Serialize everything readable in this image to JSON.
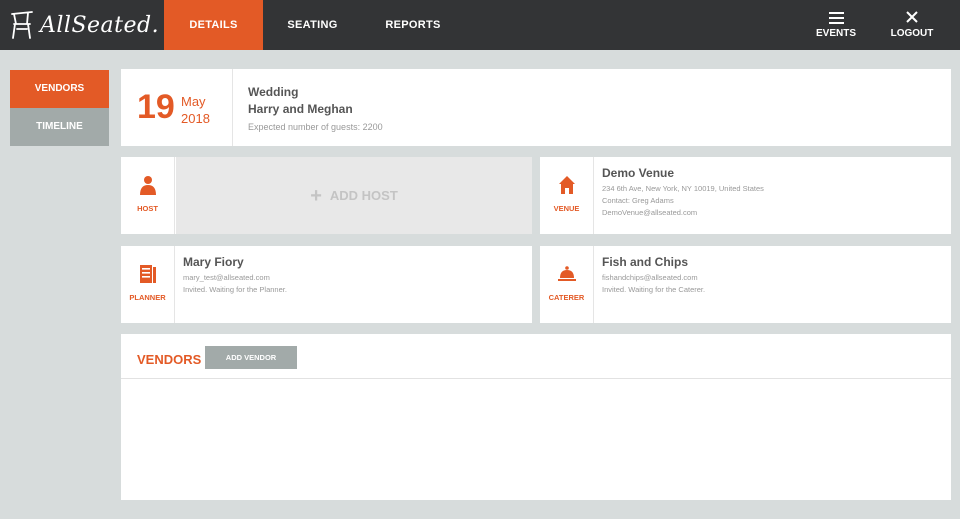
{
  "app": {
    "logo_text": "AllSeated."
  },
  "topbar": {
    "tabs": [
      {
        "label": "DETAILS",
        "active": true
      },
      {
        "label": "SEATING",
        "active": false
      },
      {
        "label": "REPORTS",
        "active": false
      }
    ],
    "actions": [
      {
        "label": "EVENTS",
        "icon": "hamburger-menu-icon"
      },
      {
        "label": "LOGOUT",
        "icon": "close-icon"
      }
    ]
  },
  "sidebar": {
    "items": [
      {
        "label": "VENDORS",
        "active": true
      },
      {
        "label": "TIMELINE",
        "active": false
      }
    ]
  },
  "event": {
    "day": "19",
    "month": "May",
    "year": "2018",
    "type": "Wedding",
    "name": "Harry and Meghan",
    "guests": "Expected number of guests: 2200"
  },
  "host": {
    "role": "HOST",
    "add_label": "ADD HOST",
    "icon": "person-icon"
  },
  "venue": {
    "role": "VENUE",
    "icon": "house-icon",
    "name": "Demo Venue",
    "address": "234 6th Ave, New York, NY 10019, United States",
    "contact": "Contact: Greg Adams",
    "email": "DemoVenue@allseated.com"
  },
  "planner": {
    "role": "PLANNER",
    "icon": "clipboard-icon",
    "name": "Mary Fiory",
    "email": "mary_test@allseated.com",
    "status": "Invited. Waiting for the Planner."
  },
  "caterer": {
    "role": "CATERER",
    "icon": "cloche-icon",
    "name": "Fish and Chips",
    "email": "fishandchips@allseated.com",
    "status": "Invited. Waiting for the Caterer."
  },
  "vendors": {
    "title": "VENDORS",
    "add_label": "ADD VENDOR"
  },
  "colors": {
    "accent": "#e35a26",
    "topbar": "#333436",
    "muted_button": "#a2aaa9",
    "background": "#d7dcdc"
  }
}
